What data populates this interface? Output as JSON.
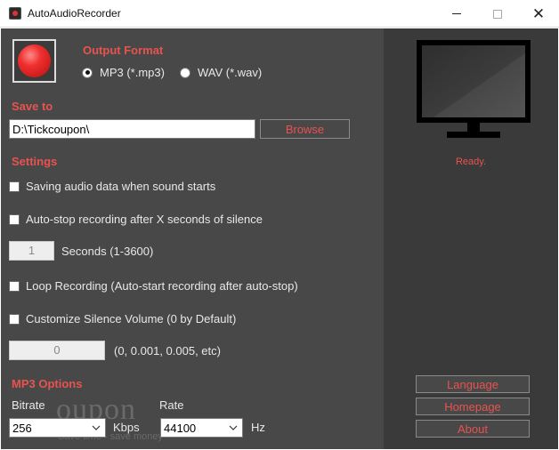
{
  "window": {
    "title": "AutoAudioRecorder",
    "close_glyph": "✕"
  },
  "output_format": {
    "title": "Output Format",
    "options": [
      {
        "label": "MP3 (*.mp3)",
        "selected": true
      },
      {
        "label": "WAV (*.wav)",
        "selected": false
      }
    ]
  },
  "save_to": {
    "title": "Save to",
    "path": "D:\\Tickcoupon\\",
    "browse_label": "Browse"
  },
  "settings": {
    "title": "Settings",
    "save_on_sound": {
      "label": "Saving audio data when sound starts",
      "checked": false
    },
    "auto_stop": {
      "label": "Auto-stop recording after X seconds of silence",
      "checked": false
    },
    "seconds": {
      "value": "1",
      "label": "Seconds (1-3600)"
    },
    "loop": {
      "label": "Loop Recording (Auto-start recording after auto-stop)",
      "checked": false
    },
    "silence_volume": {
      "label": "Customize Silence Volume (0 by Default)",
      "checked": false
    },
    "volume": {
      "value": "0",
      "hint": "(0, 0.001, 0.005, etc)"
    }
  },
  "mp3_options": {
    "title": "MP3 Options",
    "bitrate_label": "Bitrate",
    "bitrate_value": "256",
    "bitrate_unit": "Kbps",
    "rate_label": "Rate",
    "rate_value": "44100",
    "rate_unit": "Hz"
  },
  "status": "Ready.",
  "side_buttons": {
    "language": "Language",
    "homepage": "Homepage",
    "about": "About"
  },
  "watermark": {
    "brand": "oupon",
    "tagline": "Save time - save money"
  },
  "colors": {
    "accent": "#e8534f",
    "panel": "#484848",
    "sidebar": "#3a3a3a"
  },
  "icons": {
    "record": "record-icon",
    "monitor": "monitor-icon"
  }
}
